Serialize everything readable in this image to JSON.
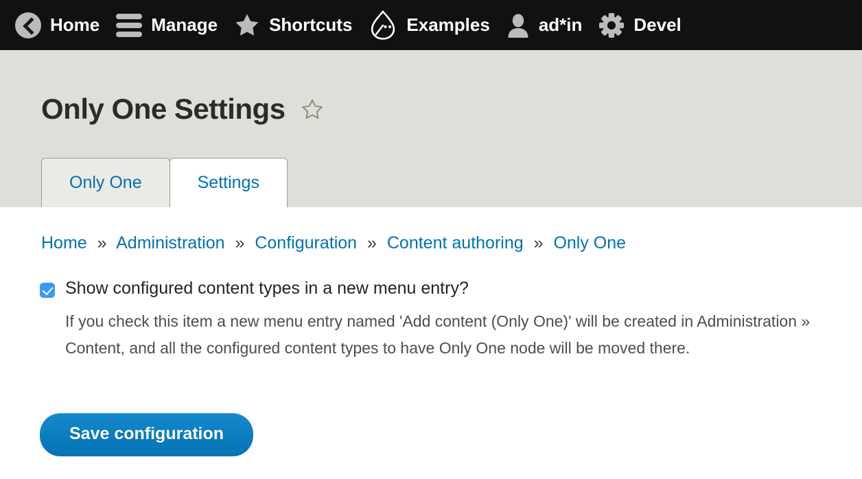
{
  "toolbar": {
    "items": [
      {
        "label": "Home",
        "icon": "back-arrow-circle-icon"
      },
      {
        "label": "Manage",
        "icon": "hamburger-menu-icon"
      },
      {
        "label": "Shortcuts",
        "icon": "star-icon"
      },
      {
        "label": "Examples",
        "icon": "drupal-droplet-icon"
      },
      {
        "label": "ad*in",
        "icon": "user-person-icon"
      },
      {
        "label": "Devel",
        "icon": "gear-icon"
      }
    ],
    "background_color": "#111111",
    "icon_color": "#bbbbbb",
    "text_color": "#ffffff"
  },
  "page": {
    "title": "Only One Settings",
    "favorite_icon": "star-outline-icon",
    "header_background": "#dfdfd9"
  },
  "tabs": [
    {
      "label": "Only One",
      "active": false
    },
    {
      "label": "Settings",
      "active": true
    }
  ],
  "breadcrumb": {
    "separator": "»",
    "items": [
      "Home",
      "Administration",
      "Configuration",
      "Content authoring",
      "Only One"
    ],
    "link_color": "#0071b3"
  },
  "form": {
    "checkbox": {
      "label": "Show configured content types in a new menu entry?",
      "checked": true,
      "accent_color": "#3b99f5"
    },
    "description": "If you check this item a new menu entry named 'Add content (Only One)' will be created in Administration » Content, and all the configured content types to have Only One node will be moved there.",
    "submit_label": "Save configuration",
    "submit_color": "#0c7ec1"
  }
}
